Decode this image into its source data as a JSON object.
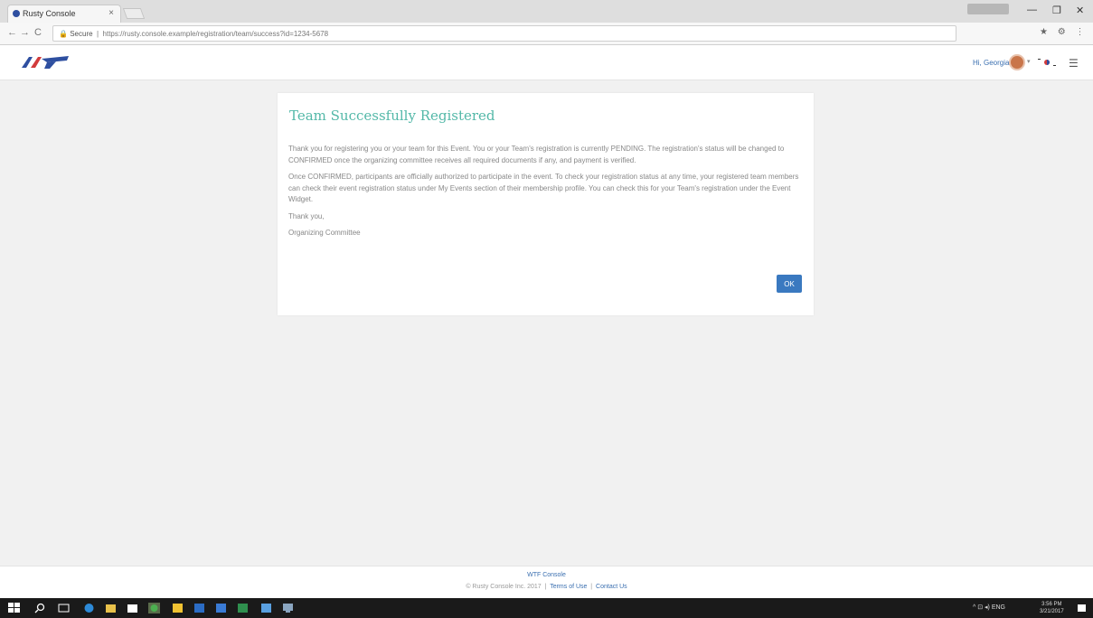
{
  "browser": {
    "tab_title": "Rusty Console",
    "tab_close": "×",
    "url_secure_label": "Secure",
    "url": "https://rusty.console.example/registration/team/success?id=1234-5678",
    "window_controls": {
      "minimize": "—",
      "maximize": "❐",
      "close": "✕"
    },
    "nav": {
      "back": "←",
      "forward": "→",
      "reload": "C"
    },
    "ext_icons": "★ ⚙ ⋮"
  },
  "header": {
    "user_name": "Hi, Georgia",
    "avatar_chevron": "▾",
    "menu": "☰"
  },
  "card": {
    "title": "Team Successfully Registered",
    "paragraph_1": "Thank you for registering you or your team for this Event. You or your Team's registration is currently PENDING. The registration's status will be changed to CONFIRMED once the organizing committee receives all required documents if any, and payment is verified.",
    "paragraph_2": "Once CONFIRMED, participants are officially authorized to participate in the event. To check your registration status at any time, your registered team members can check their event registration status under My Events section of their membership profile. You can check this for your Team's registration under the Event Widget.",
    "thank_you": "Thank you,",
    "signature": "Organizing Committee",
    "ok_button": "OK"
  },
  "footer": {
    "brand": "WTF Console",
    "copyright": "© Rusty Console Inc. 2017",
    "terms_link": "Terms of Use",
    "privacy_link": "Contact Us"
  },
  "taskbar": {
    "tray_text": "^ ⊡ ◂) ENG",
    "time": "3:56 PM",
    "date": "3/21/2017"
  },
  "colors": {
    "title_accent": "#53b8a8",
    "primary_button": "#3a79c0",
    "link": "#3a6fb0"
  }
}
